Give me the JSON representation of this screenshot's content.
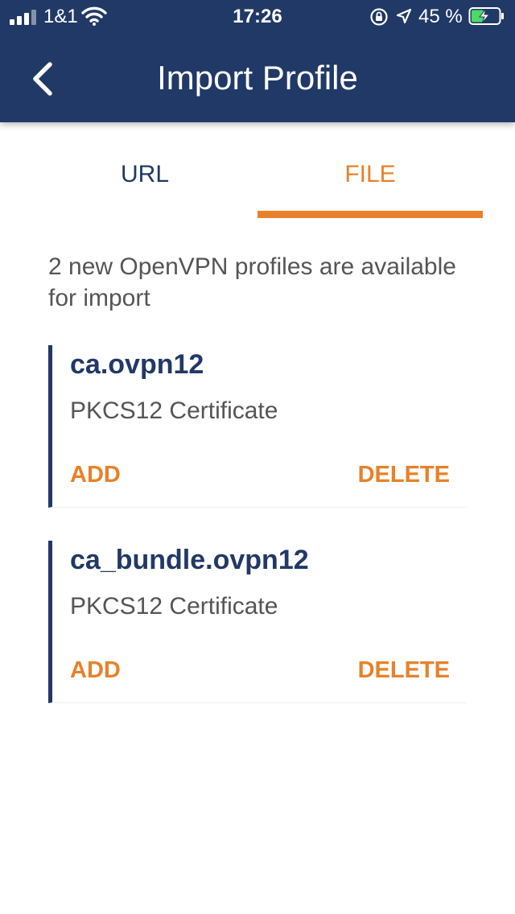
{
  "status_bar": {
    "carrier": "1&1",
    "time": "17:26",
    "battery_percent": "45 %",
    "battery_level": 0.45,
    "icons": [
      "signal-icon",
      "wifi-icon",
      "rotation-lock-icon",
      "location-arrow-icon",
      "battery-charging-icon"
    ]
  },
  "header": {
    "title": "Import Profile",
    "back_icon": "chevron-left-icon",
    "background_color": "#213966"
  },
  "tabs": [
    {
      "label": "URL",
      "selected": false
    },
    {
      "label": "FILE",
      "selected": true
    }
  ],
  "info_text": "2 new OpenVPN profiles are available for import",
  "profiles": [
    {
      "name": "ca.ovpn12",
      "type": "PKCS12 Certificate",
      "add_label": "ADD",
      "delete_label": "DELETE"
    },
    {
      "name": "ca_bundle.ovpn12",
      "type": "PKCS12 Certificate",
      "add_label": "ADD",
      "delete_label": "DELETE"
    }
  ],
  "colors": {
    "primary": "#213966",
    "accent": "#e8812a",
    "text_secondary": "#555555"
  }
}
